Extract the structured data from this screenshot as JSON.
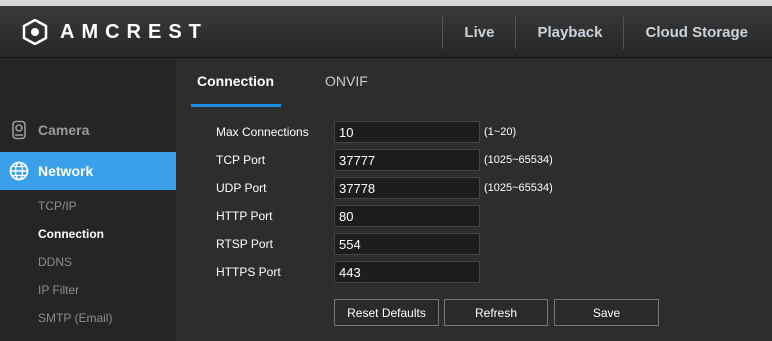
{
  "header": {
    "brand": "AMCREST",
    "nav": [
      "Live",
      "Playback",
      "Cloud Storage"
    ]
  },
  "sidebar": {
    "categories": [
      {
        "label": "Camera",
        "icon": "camera-icon"
      },
      {
        "label": "Network",
        "icon": "network-globe-icon"
      }
    ],
    "sub_items": [
      "TCP/IP",
      "Connection",
      "DDNS",
      "IP Filter",
      "SMTP (Email)"
    ],
    "active_sub": "Connection"
  },
  "tabs": [
    "Connection",
    "ONVIF"
  ],
  "form": {
    "fields": [
      {
        "label": "Max Connections",
        "value": "10",
        "range": "(1~20)"
      },
      {
        "label": "TCP Port",
        "value": "37777",
        "range": "(1025~65534)"
      },
      {
        "label": "UDP Port",
        "value": "37778",
        "range": "(1025~65534)"
      },
      {
        "label": "HTTP Port",
        "value": "80",
        "range": ""
      },
      {
        "label": "RTSP Port",
        "value": "554",
        "range": ""
      },
      {
        "label": "HTTPS Port",
        "value": "443",
        "range": ""
      }
    ]
  },
  "buttons": {
    "reset": "Reset Defaults",
    "refresh": "Refresh",
    "save": "Save"
  },
  "colors": {
    "accent": "#1a8fe0",
    "network_highlight": "#3aa0ea"
  }
}
